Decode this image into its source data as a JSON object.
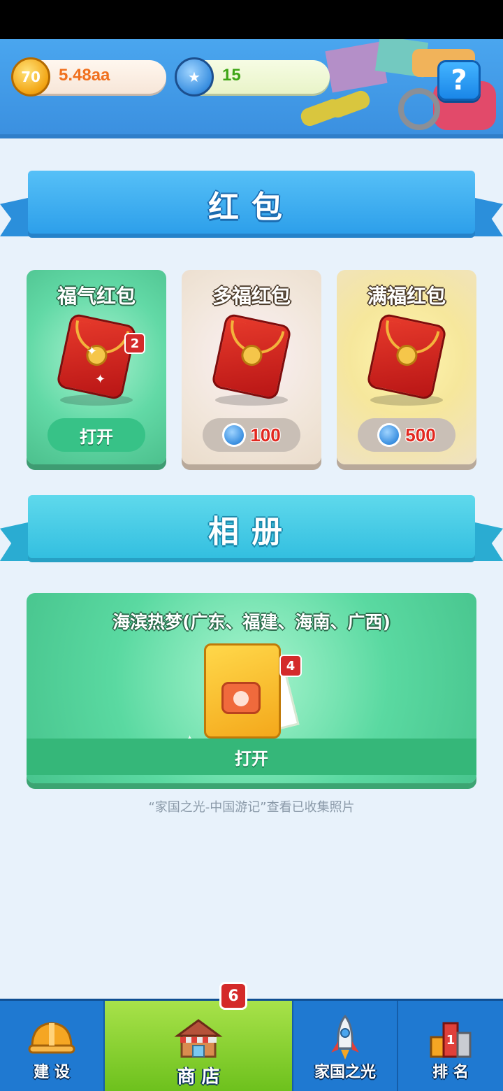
{
  "header": {
    "gold_value": "5.48aa",
    "gold_coin_glyph": "70",
    "gem_value": "15",
    "help_label": "?"
  },
  "sections": {
    "red_packet_title": "红包",
    "album_title": "相册"
  },
  "cards": [
    {
      "title": "福气红包",
      "badge": "2",
      "action": "打开"
    },
    {
      "title": "多福红包",
      "price": "100"
    },
    {
      "title": "满福红包",
      "price": "500"
    }
  ],
  "album": {
    "name": "海滨热梦(广东、福建、海南、广西)",
    "badge": "4",
    "action": "打开",
    "note": "“家国之光-中国游记”查看已收集照片"
  },
  "nav": {
    "items": [
      {
        "label": "建 设",
        "icon": "hardhat-icon"
      },
      {
        "label": "商 店",
        "icon": "shop-icon"
      },
      {
        "label": "家国之光",
        "icon": "rocket-icon"
      },
      {
        "label": "排 名",
        "icon": "ranking-icon"
      }
    ],
    "shop_badge": "6"
  },
  "colors": {
    "header_blue": "#3b90e0",
    "ribbon_blue": "#2d9fea",
    "ribbon_cyan": "#33bfe0",
    "card_green": "#62d9a6",
    "price_red": "#e2281f",
    "nav_blue": "#1f79d1",
    "nav_active_green": "#6cc01c",
    "badge_red": "#d42a2a"
  }
}
